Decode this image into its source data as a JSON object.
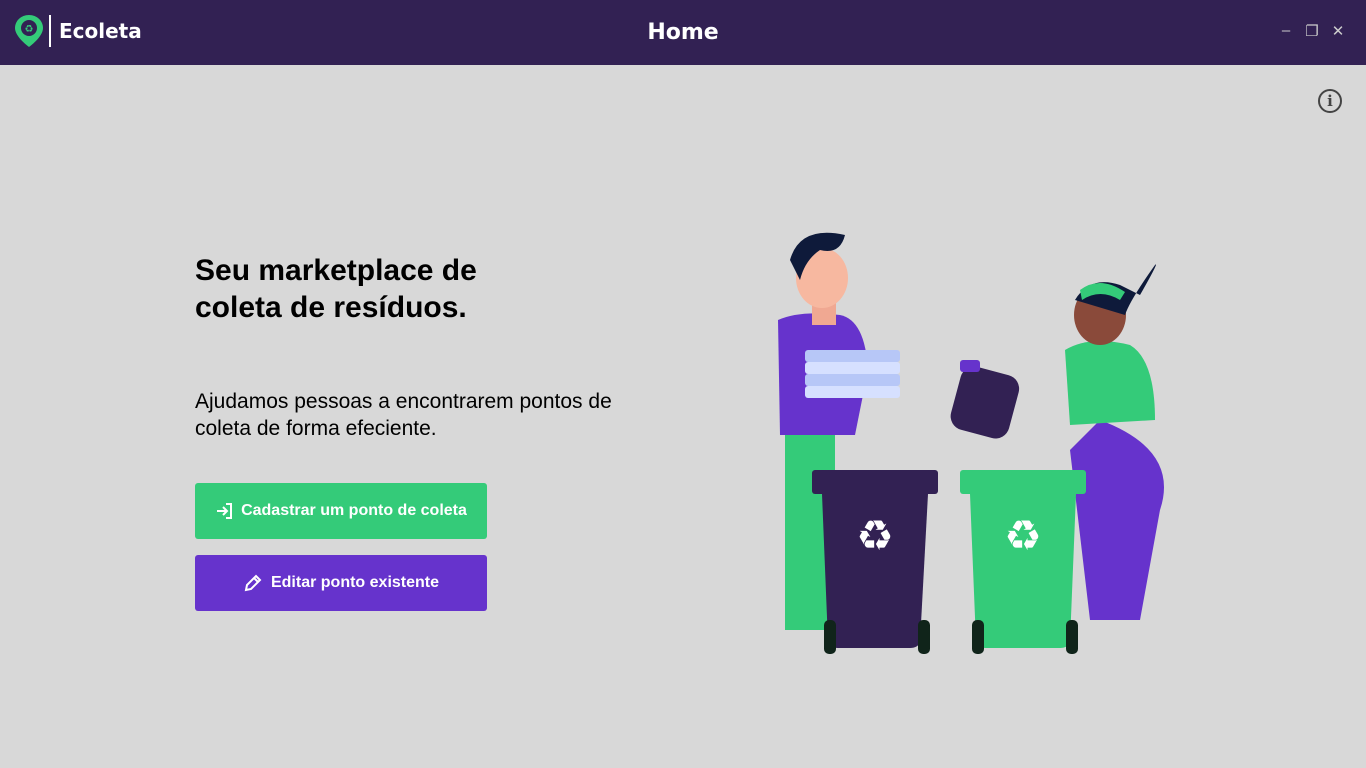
{
  "app": {
    "name": "Ecoleta",
    "window_title": "Home"
  },
  "window_controls": {
    "minimize": "–",
    "maximize": "❐",
    "close": "✕"
  },
  "hero": {
    "heading": "Seu marketplace de coleta de resíduos.",
    "subtitle": "Ajudamos pessoas a encontrarem pontos de coleta de forma efeciente."
  },
  "buttons": {
    "register": "Cadastrar um ponto de coleta",
    "edit": "Editar ponto existente"
  },
  "info_icon": "i",
  "colors": {
    "titlebar": "#322153",
    "green": "#34cb79",
    "purple": "#6633cc",
    "background": "#d8d8d8"
  }
}
